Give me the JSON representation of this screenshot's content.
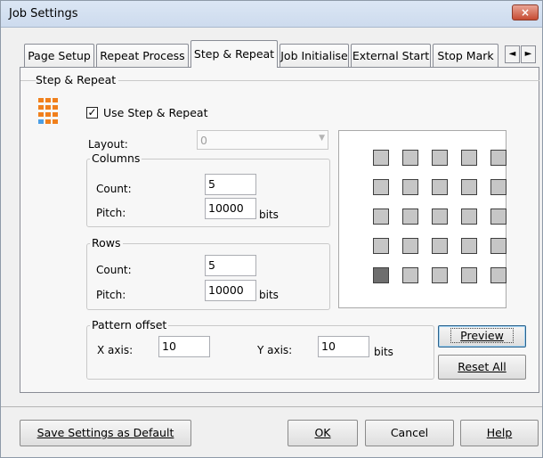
{
  "window": {
    "title": "Job Settings",
    "close_label": "×"
  },
  "tabs": [
    {
      "label": "Page Setup"
    },
    {
      "label": "Repeat Process"
    },
    {
      "label": "Step & Repeat"
    },
    {
      "label": "Job Initialise"
    },
    {
      "label": "External Start"
    },
    {
      "label": "Stop Mark"
    }
  ],
  "tab_scroll": {
    "left": "◄",
    "right": "►"
  },
  "step_repeat": {
    "group_title": "Step & Repeat",
    "use_checkbox_label": "Use Step & Repeat",
    "use_checked": true,
    "check_glyph": "✓",
    "layout_label": "Layout:",
    "layout_value": "0",
    "layout_arrow": "▼",
    "columns": {
      "title": "Columns",
      "count_label": "Count:",
      "count_value": "5",
      "pitch_label": "Pitch:",
      "pitch_value": "10000",
      "unit": "bits"
    },
    "rows": {
      "title": "Rows",
      "count_label": "Count:",
      "count_value": "5",
      "pitch_label": "Pitch:",
      "pitch_value": "10000",
      "unit": "bits"
    },
    "offset": {
      "title": "Pattern offset",
      "x_label": "X axis:",
      "x_value": "10",
      "y_label": "Y axis:",
      "y_value": "10",
      "unit": "bits"
    },
    "preview_button": "Preview",
    "reset_button": "Reset All",
    "preview_grid": {
      "rows": 5,
      "cols": 5,
      "highlighted": "bottom-left"
    }
  },
  "footer": {
    "save_default": "Save Settings as Default",
    "ok": "OK",
    "cancel": "Cancel",
    "help": "Help"
  },
  "colors": {
    "title_close": "#c64b32",
    "icon_orange": "#f0801c",
    "icon_blue": "#4a9ee6"
  }
}
